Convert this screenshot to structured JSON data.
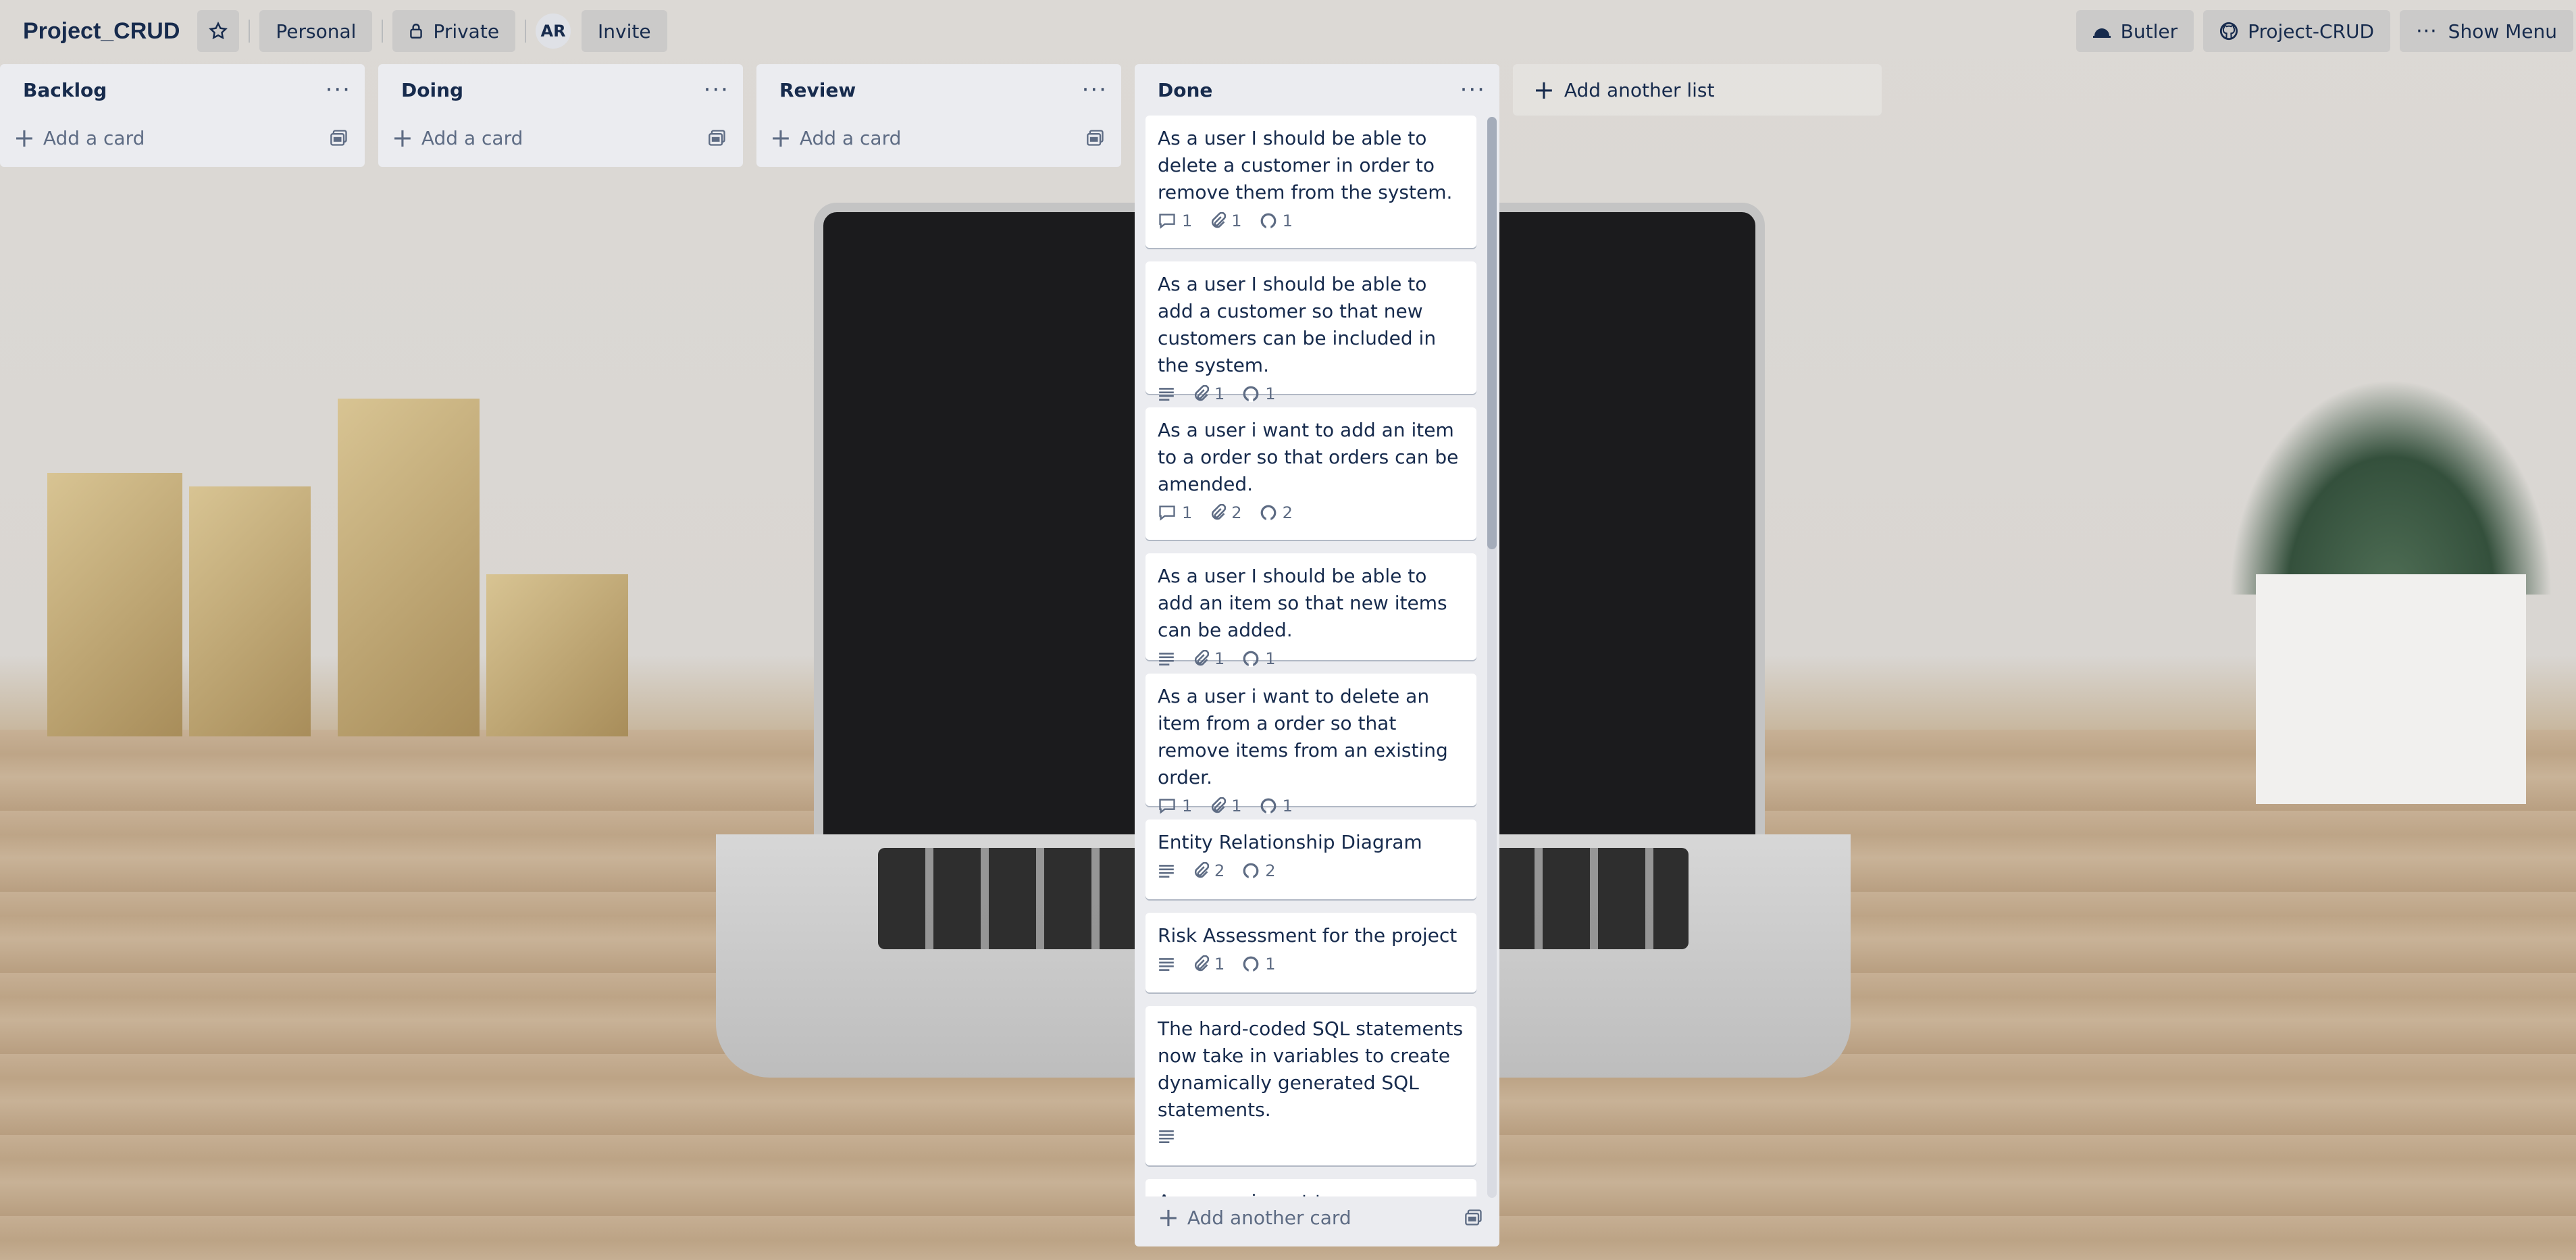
{
  "header": {
    "board_title": "Project_CRUD",
    "workspace_label": "Personal",
    "visibility_label": "Private",
    "avatar_initials": "AR",
    "invite_label": "Invite",
    "butler_label": "Butler",
    "github_label": "Project-CRUD",
    "menu_label": "Show Menu"
  },
  "lists": [
    {
      "title": "Backlog",
      "add_label": "Add a card"
    },
    {
      "title": "Doing",
      "add_label": "Add a card"
    },
    {
      "title": "Review",
      "add_label": "Add a card"
    },
    {
      "title": "Done",
      "add_label": "Add another card"
    }
  ],
  "done_cards": [
    {
      "text": "As a user I should be able to delete a customer in order to remove them from the system.",
      "comments": "1",
      "attachments": "1",
      "github": "1"
    },
    {
      "text": "As a user I should be able to add a customer so that new customers can be included in the system.",
      "attachments": "1",
      "github": "1"
    },
    {
      "text": "As a user i want to add an item to a order so that orders can be amended.",
      "comments": "1",
      "attachments": "2",
      "github": "2"
    },
    {
      "text": "As a user I should be able to add an item so that new items can be added.",
      "attachments": "1",
      "github": "1"
    },
    {
      "text": "As a user i want to delete an item from a order so that remove items from an existing order.",
      "comments": "1",
      "attachments": "1",
      "github": "1"
    },
    {
      "text": "Entity Relationship Diagram",
      "attachments": "2",
      "github": "2"
    },
    {
      "text": "Risk Assessment for the project",
      "attachments": "1",
      "github": "1"
    },
    {
      "text": "The hard-coded SQL statements now take in variables to create dynamically generated SQL statements."
    },
    {
      "text": "As a user i want to ..."
    }
  ],
  "add_list_label": "Add another list"
}
